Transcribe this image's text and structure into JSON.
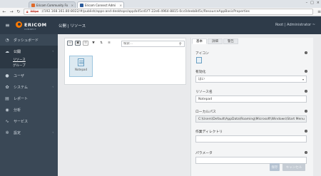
{
  "browser": {
    "tabs": [
      {
        "title": "Ericom Community Fo",
        "active": false,
        "color": "#e06a2a"
      },
      {
        "title": "Ericom Connect Admi",
        "active": true,
        "color": "#2a5a9a"
      }
    ],
    "address": {
      "scheme": "https",
      "url": "://192.168.161.80:8022/#/publish/apps-and-desktops/app/b45cd1f7-22e6-4964-8815-0cc0deeb8d5c/ResourceAppBasicProperties"
    }
  },
  "header": {
    "logo_text": "ERICOM",
    "logo_sub": "CONNECT",
    "breadcrumb": "公開 | リソース",
    "user_menu": "Root | Administrator ~"
  },
  "sidebar": {
    "items": [
      {
        "label": "ダッシュボード",
        "icon": "dashboard-icon",
        "glyph": "◔",
        "badge": ""
      },
      {
        "label": "公開",
        "icon": "cloud-icon",
        "glyph": "☁",
        "badge": "<",
        "active": true
      },
      {
        "label": "ユーザ",
        "icon": "user-icon",
        "glyph": "●",
        "badge": ""
      },
      {
        "label": "システム",
        "icon": "gear-icon",
        "glyph": "✿",
        "badge": "<"
      },
      {
        "label": "レポート",
        "icon": "document-icon",
        "glyph": "▤",
        "badge": ""
      },
      {
        "label": "分析",
        "icon": "globe-icon",
        "glyph": "◉",
        "badge": ""
      },
      {
        "label": "サービス",
        "icon": "pulse-icon",
        "glyph": "∿",
        "badge": ""
      },
      {
        "label": "設定",
        "icon": "settings-icon",
        "glyph": "✲",
        "badge": "<"
      }
    ],
    "sub_items": [
      {
        "label": "リソース",
        "selected": true
      },
      {
        "label": "グループ",
        "selected": false
      }
    ]
  },
  "resources": {
    "search_placeholder": "検索...",
    "toolbar": [
      {
        "name": "app-icon",
        "glyph": "▭"
      },
      {
        "name": "desktop-icon",
        "glyph": "▣"
      },
      {
        "name": "delete-icon",
        "glyph": "⊠"
      },
      {
        "name": "filter-icon",
        "glyph": "▼"
      },
      {
        "name": "sort-icon",
        "glyph": "⇅"
      },
      {
        "name": "list-icon",
        "glyph": "≡"
      }
    ],
    "tiles": [
      {
        "label": "Notepad"
      }
    ]
  },
  "properties": {
    "tabs": [
      "基本",
      "詳細",
      "警告"
    ],
    "active_tab": "基本",
    "fields": {
      "icon_label": "アイコン",
      "enabled_label": "有効化",
      "enabled_value": "はい",
      "resource_name_label": "リソース名",
      "resource_name_value": "Notepad",
      "local_path_label": "ローカルパス",
      "local_path_value": "C:\\Users\\Default\\AppData\\Roaming\\Microsoft\\Windows\\Start Menu",
      "working_dir_label": "作業ディレクトリ",
      "working_dir_value": "",
      "params_label": "パラメータ"
    },
    "save_label": "保存",
    "cancel_label": "キャンセル"
  }
}
